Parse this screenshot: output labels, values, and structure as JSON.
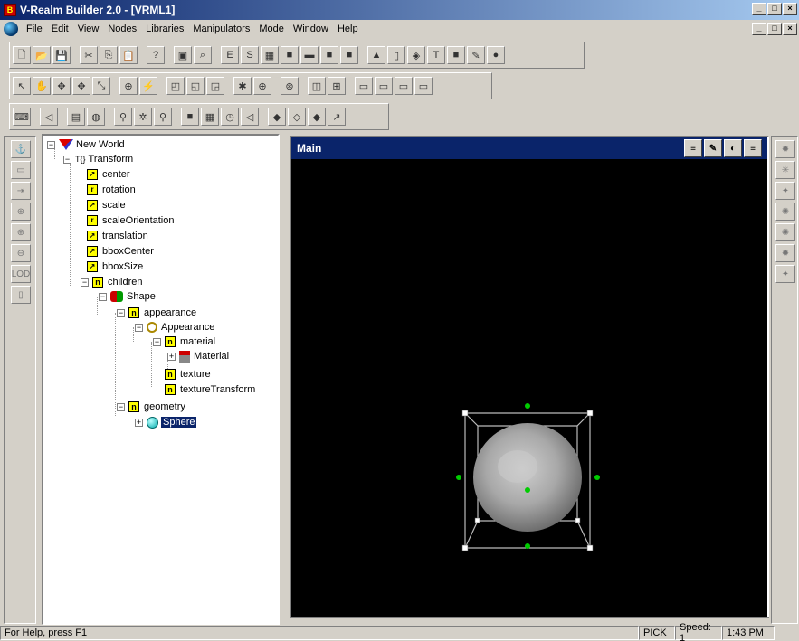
{
  "window": {
    "title": "V-Realm Builder 2.0 - [VRML1]",
    "minimize": "_",
    "maximize": "□",
    "close": "×",
    "app_icon_letter": "B"
  },
  "menu": {
    "items": [
      "File",
      "Edit",
      "View",
      "Nodes",
      "Libraries",
      "Manipulators",
      "Mode",
      "Window",
      "Help"
    ]
  },
  "toolbars": {
    "row1": [
      "new",
      "open",
      "save",
      "cut",
      "copy",
      "paste",
      "help",
      "camera",
      "zoom",
      "field-e",
      "field-s",
      "node-a",
      "node-b",
      "node-c",
      "node-d",
      "node-e",
      "cone",
      "cylinder",
      "extrusion",
      "text",
      "box2",
      "pen",
      "sphere"
    ],
    "row1_glyphs": [
      "🗋",
      "📂",
      "💾",
      "✂",
      "⎘",
      "📋",
      "?",
      "▣",
      "⌕",
      "E",
      "S",
      "▦",
      "■",
      "▬",
      "■",
      "■",
      "▲",
      "▯",
      "◈",
      "T",
      "■",
      "✎",
      "●"
    ],
    "row2_glyphs": [
      "↖",
      "✋",
      "✥",
      "✥",
      "⤡",
      "⊕",
      "⚡",
      "◰",
      "◱",
      "◲",
      "✱",
      "⊕",
      "⊛",
      "◫",
      "⊞",
      "▭",
      "▭",
      "▭",
      "▭"
    ],
    "row3_glyphs": [
      "⌨",
      "◁",
      "▤",
      "◍",
      "⚲",
      "✲",
      "⚲",
      "■",
      "▦",
      "◷",
      "◁",
      "◆",
      "◇",
      "◆",
      "↗"
    ]
  },
  "left_tools": [
    "⚓",
    "▭",
    "⇥",
    "⊕",
    "⊕",
    "⊖",
    "LOD",
    "▯"
  ],
  "right_tools": [
    "✹",
    "✳",
    "✦",
    "✺",
    "✺",
    "✹",
    "✦"
  ],
  "tree": {
    "root": "New World",
    "transform": "Transform",
    "transform_prefix": "T{}",
    "fields": [
      "center",
      "rotation",
      "scale",
      "scaleOrientation",
      "translation",
      "bboxCenter",
      "bboxSize"
    ],
    "field_icons": [
      "↗",
      "r",
      "↗",
      "r",
      "↗",
      "↗",
      "↗"
    ],
    "children": "children",
    "shape": "Shape",
    "appearance_field": "appearance",
    "appearance_node": "Appearance",
    "material_field": "material",
    "material_node": "Material",
    "texture": "texture",
    "texture_transform": "textureTransform",
    "geometry": "geometry",
    "sphere": "Sphere",
    "expand_minus": "−",
    "expand_plus": "+",
    "node_letter": "n"
  },
  "viewport": {
    "title": "Main",
    "buttons": [
      "≡",
      "✎",
      "◐",
      "≡"
    ]
  },
  "status": {
    "help": "For Help, press F1",
    "mode": "PICK",
    "speed": "Speed: 1",
    "time": "1:43 PM"
  },
  "colors": {
    "titlebar": "#0a246a",
    "selection": "#0a246a",
    "viewport_bg": "#000000",
    "handle_green": "#00cc00",
    "field_icon": "#ffff00"
  }
}
